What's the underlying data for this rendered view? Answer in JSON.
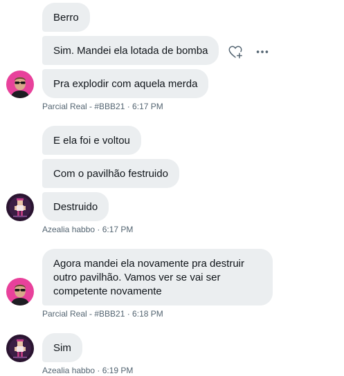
{
  "messages": [
    {
      "text": "Berro"
    },
    {
      "text": "Sim. Mandei ela lotada de bomba"
    },
    {
      "text": "Pra explodir com aquela merda"
    },
    {
      "text": "E ela foi e voltou"
    },
    {
      "text": "Com o pavilhão festruido"
    },
    {
      "text": "Destruido"
    },
    {
      "text": "Agora mandei ela novamente pra destruir outro pavilhão. Vamos ver se vai ser competente novamente"
    },
    {
      "text": "Sim"
    }
  ],
  "meta": {
    "m1": "Parcial Real - #BBB21 · 6:17 PM",
    "m2": "Azealia habbo · 6:17 PM",
    "m3": "Parcial Real - #BBB21 · 6:18 PM",
    "m4": "Azealia habbo · 6:19 PM"
  },
  "icons": {
    "react": "heart-plus-icon",
    "more": "more-horizontal-icon"
  },
  "colors": {
    "bubble": "#ebeef0",
    "text": "#0f1419",
    "meta": "#536471",
    "avatar_pink": "#e8419b",
    "avatar_dark": "#2a1430"
  }
}
